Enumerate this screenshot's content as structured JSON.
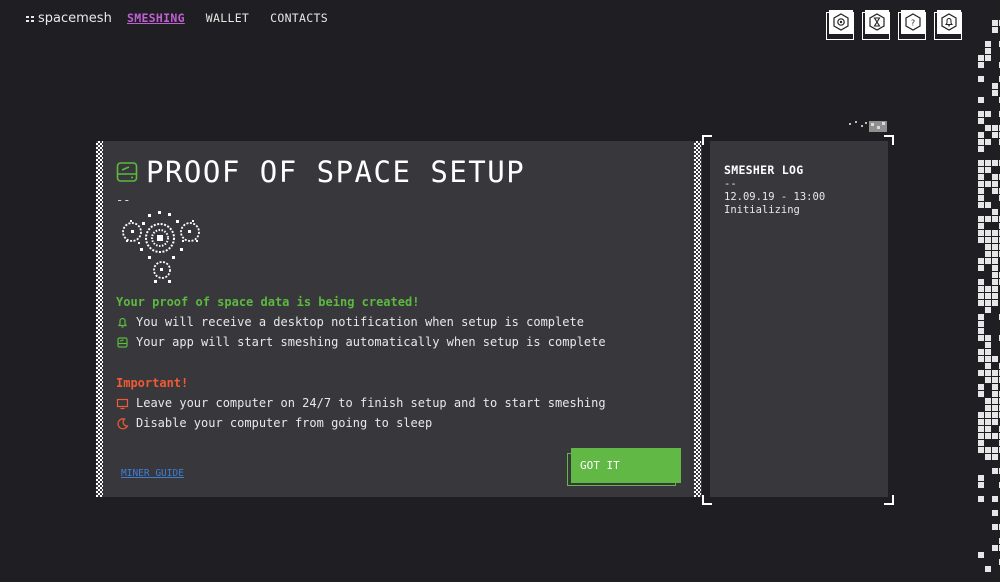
{
  "header": {
    "logo_text": "spacemesh",
    "nav": [
      {
        "label": "SMESHING",
        "active": true
      },
      {
        "label": "WALLET",
        "active": false
      },
      {
        "label": "CONTACTS",
        "active": false
      }
    ],
    "icons": [
      "settings-icon",
      "hourglass-icon",
      "help-icon",
      "bell-icon"
    ]
  },
  "main": {
    "title": "PROOF OF SPACE SETUP",
    "dash": "--",
    "status_message": "Your proof of space data is being created!",
    "info_items": [
      {
        "icon": "bell-icon",
        "text": "You will receive a desktop notification when setup is complete"
      },
      {
        "icon": "drive-icon",
        "text": "Your app will start smeshing automatically when setup is complete"
      }
    ],
    "important_heading": "Important!",
    "warning_items": [
      {
        "icon": "monitor-icon",
        "text": "Leave your computer on 24/7 to finish setup and to start smeshing"
      },
      {
        "icon": "moon-icon",
        "text": "Disable your computer from going to sleep"
      }
    ],
    "guide_link": "MINER GUIDE",
    "confirm_button": "GOT IT"
  },
  "log": {
    "title": "SMESHER LOG",
    "dash": "--",
    "entries": [
      {
        "time": "12.09.19 - 13:00",
        "text": "Initializing"
      }
    ]
  },
  "colors": {
    "background": "#1f1e22",
    "panel": "#38373b",
    "accent_purple": "#c060d4",
    "accent_green": "#62b845",
    "status_green": "#5bba3f",
    "warning_red": "#ef5b35",
    "link_blue": "#3f7ed6"
  }
}
